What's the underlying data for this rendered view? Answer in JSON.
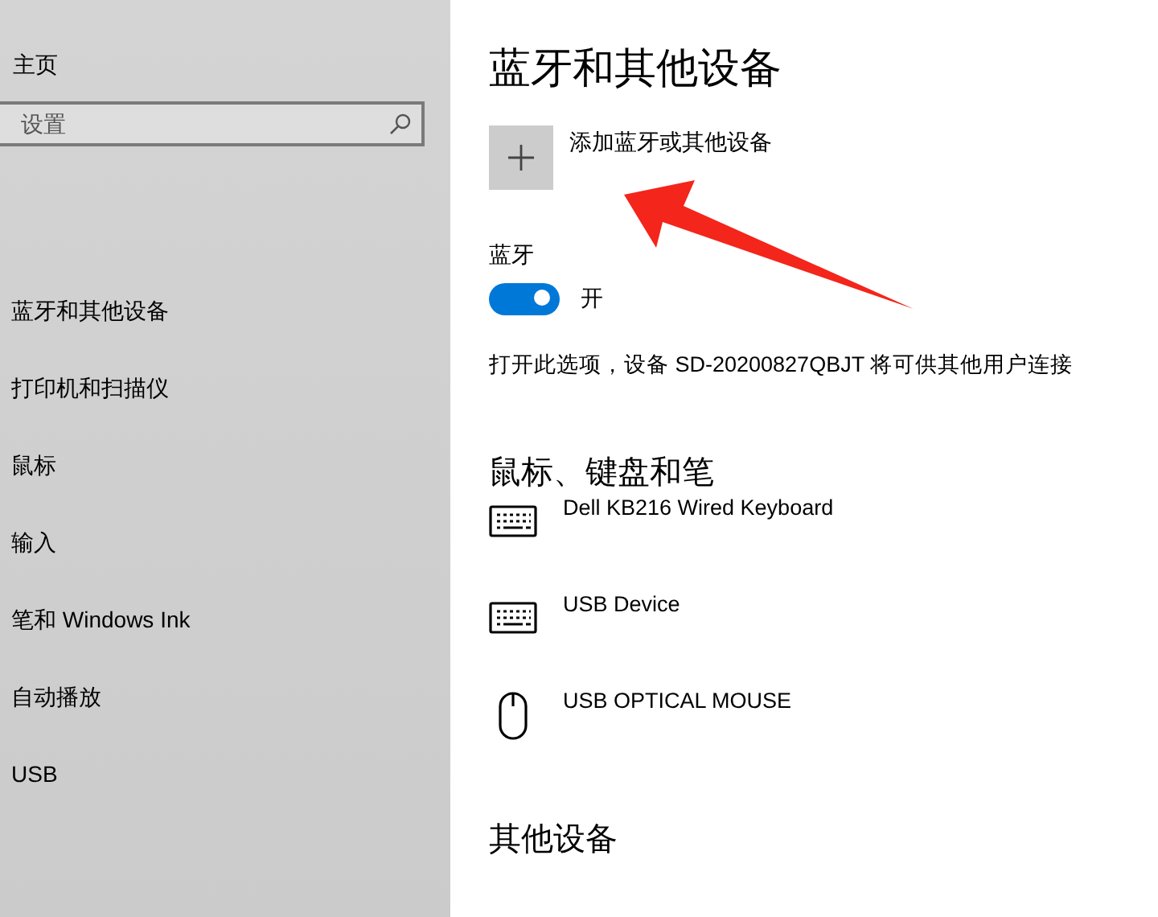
{
  "sidebar": {
    "home": "主页",
    "search": {
      "placeholder": "设置"
    },
    "items": [
      {
        "label": "蓝牙和其他设备"
      },
      {
        "label": "打印机和扫描仪"
      },
      {
        "label": "鼠标"
      },
      {
        "label": "输入"
      },
      {
        "label": "笔和 Windows Ink"
      },
      {
        "label": "自动播放"
      },
      {
        "label": "USB"
      }
    ]
  },
  "content": {
    "title": "蓝牙和其他设备",
    "add_device": "添加蓝牙或其他设备",
    "bluetooth": {
      "label": "蓝牙",
      "on": true,
      "state_text": "开"
    },
    "description": "打开此选项，设备 SD-20200827QBJT 将可供其他用户连接",
    "sections": [
      {
        "heading": "鼠标、键盘和笔",
        "devices": [
          {
            "name": "Dell KB216 Wired Keyboard",
            "kind": "keyboard"
          },
          {
            "name": "USB Device",
            "kind": "keyboard"
          },
          {
            "name": "USB OPTICAL MOUSE",
            "kind": "mouse"
          }
        ]
      },
      {
        "heading": "其他设备"
      }
    ]
  }
}
